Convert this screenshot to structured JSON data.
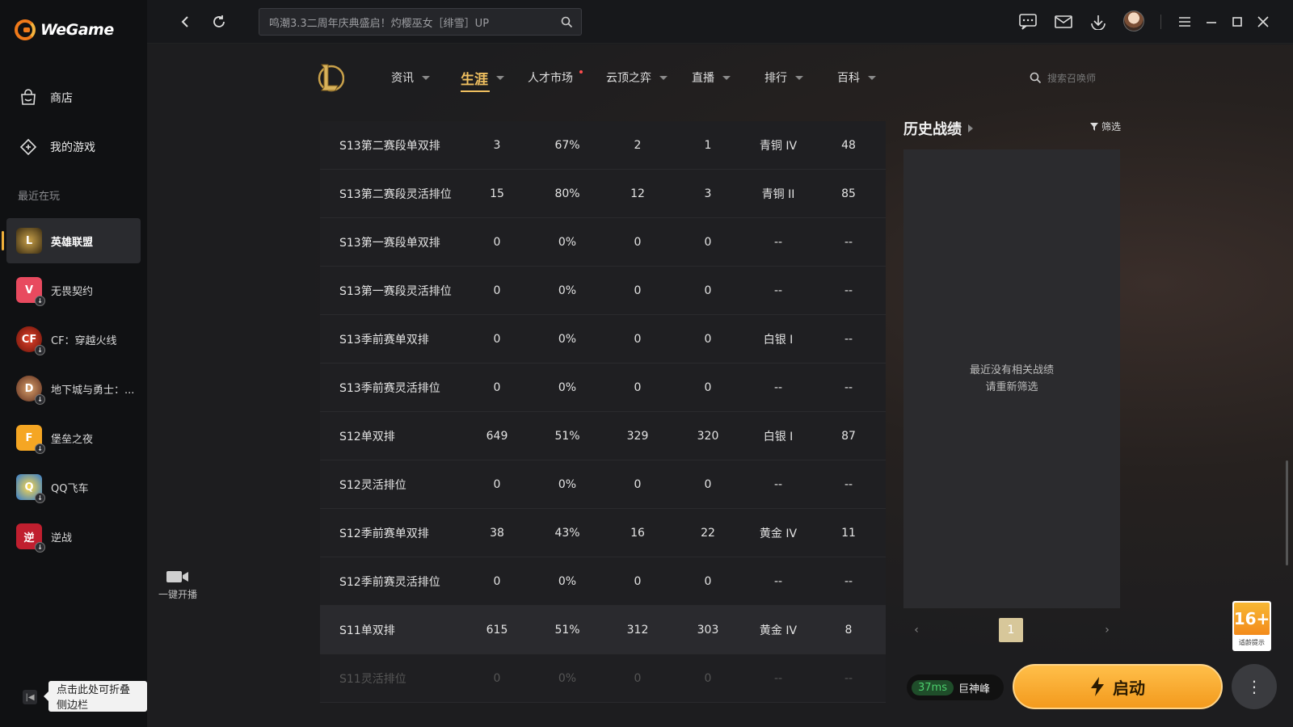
{
  "app": {
    "name": "WeGame"
  },
  "sidebar": {
    "nav": [
      {
        "label": "商店",
        "icon": "store-icon"
      },
      {
        "label": "我的游戏",
        "icon": "games-icon"
      }
    ],
    "recent_label": "最近在玩",
    "games": [
      {
        "label": "英雄联盟",
        "active": true
      },
      {
        "label": "无畏契约"
      },
      {
        "label": "CF：穿越火线"
      },
      {
        "label": "地下城与勇士：..."
      },
      {
        "label": "堡垒之夜"
      },
      {
        "label": "QQ飞车"
      },
      {
        "label": "逆战"
      }
    ],
    "collapse_tooltip": "点击此处可折叠侧边栏"
  },
  "topbar": {
    "search_text": "鸣潮3.3二周年庆典盛启！灼樱巫女［绯雪］UP"
  },
  "lol_nav": {
    "items": [
      "资讯",
      "生涯",
      "人才市场",
      "云顶之弈",
      "直播",
      "排行",
      "百科"
    ],
    "active": "生涯",
    "summoner_search_placeholder": "搜索召唤师"
  },
  "broadcast_label": "一键开播",
  "career_table": {
    "rows": [
      [
        "S13第二赛段单双排",
        "3",
        "67%",
        "2",
        "1",
        "青铜 IV",
        "48"
      ],
      [
        "S13第二赛段灵活排位",
        "15",
        "80%",
        "12",
        "3",
        "青铜 II",
        "85"
      ],
      [
        "S13第一赛段单双排",
        "0",
        "0%",
        "0",
        "0",
        "--",
        "--"
      ],
      [
        "S13第一赛段灵活排位",
        "0",
        "0%",
        "0",
        "0",
        "--",
        "--"
      ],
      [
        "S13季前赛单双排",
        "0",
        "0%",
        "0",
        "0",
        "白银 I",
        "--"
      ],
      [
        "S13季前赛灵活排位",
        "0",
        "0%",
        "0",
        "0",
        "--",
        "--"
      ],
      [
        "S12单双排",
        "649",
        "51%",
        "329",
        "320",
        "白银 I",
        "87"
      ],
      [
        "S12灵活排位",
        "0",
        "0%",
        "0",
        "0",
        "--",
        "--"
      ],
      [
        "S12季前赛单双排",
        "38",
        "43%",
        "16",
        "22",
        "黄金 IV",
        "11"
      ],
      [
        "S12季前赛灵活排位",
        "0",
        "0%",
        "0",
        "0",
        "--",
        "--"
      ],
      [
        "S11单双排",
        "615",
        "51%",
        "312",
        "303",
        "黄金 IV",
        "8"
      ],
      [
        "S11灵活排位",
        "0",
        "0%",
        "0",
        "0",
        "--",
        "--"
      ]
    ]
  },
  "history": {
    "title": "历史战绩",
    "filter_label": "筛选",
    "empty_line1": "最近没有相关战绩",
    "empty_line2": "请重新筛选",
    "page": "1"
  },
  "age_rating": {
    "badge": "16+",
    "label": "适龄提示"
  },
  "launch": {
    "ping": "37ms",
    "server": "巨神峰",
    "start_label": "启动"
  },
  "colors": {
    "accent": "#f0c060",
    "start_button": "#f7a82a"
  }
}
